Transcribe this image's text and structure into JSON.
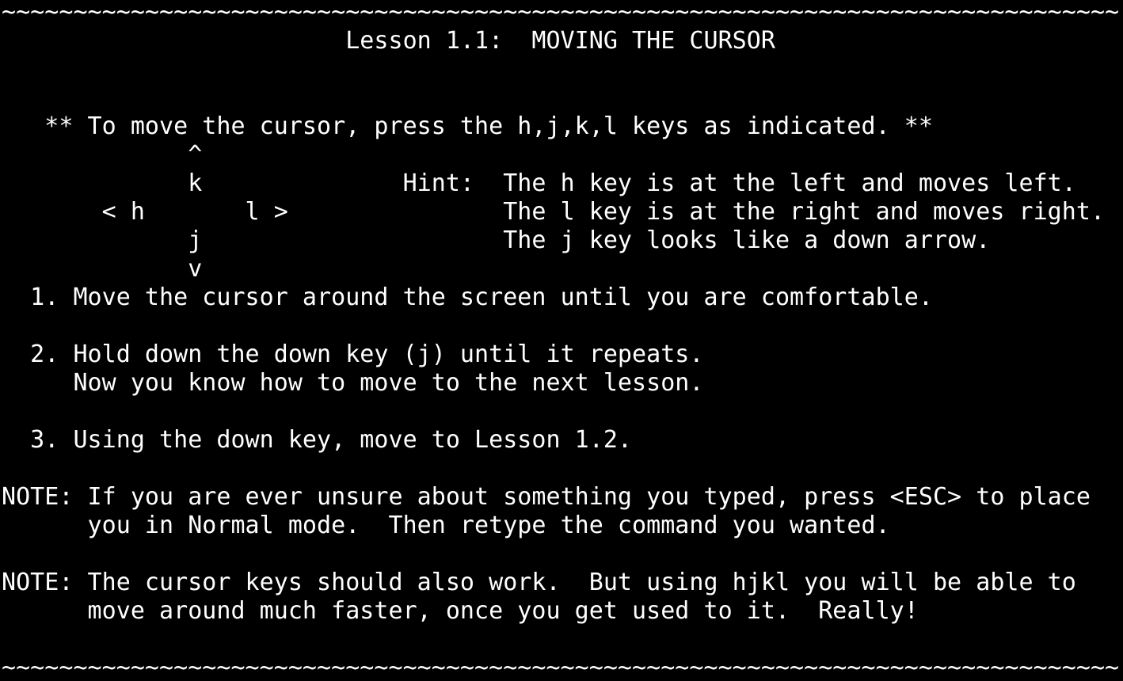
{
  "terminal": {
    "lines": [
      "~~~~~~~~~~~~~~~~~~~~~~~~~~~~~~~~~~~~~~~~~~~~~~~~~~~~~~~~~~~~~~~~~~~~~~~~~~~~~~",
      "                        Lesson 1.1:  MOVING THE CURSOR",
      "",
      "",
      "   ** To move the cursor, press the h,j,k,l keys as indicated. **",
      "             ^",
      "             k              Hint:  The h key is at the left and moves left.",
      "       < h       l >               The l key is at the right and moves right.",
      "             j                     The j key looks like a down arrow.",
      "             v",
      "  1. Move the cursor around the screen until you are comfortable.",
      "",
      "  2. Hold down the down key (j) until it repeats.",
      "     Now you know how to move to the next lesson.",
      "",
      "  3. Using the down key, move to Lesson 1.2.",
      "",
      "NOTE: If you are ever unsure about something you typed, press <ESC> to place",
      "      you in Normal mode.  Then retype the command you wanted.",
      "",
      "NOTE: The cursor keys should also work.  But using hjkl you will be able to",
      "      move around much faster, once you get used to it.  Really!",
      "",
      "~~~~~~~~~~~~~~~~~~~~~~~~~~~~~~~~~~~~~~~~~~~~~~~~~~~~~~~~~~~~~~~~~~~~~~~~~~~~~~"
    ]
  },
  "colors": {
    "background": "#000000",
    "foreground": "#ffffff"
  }
}
